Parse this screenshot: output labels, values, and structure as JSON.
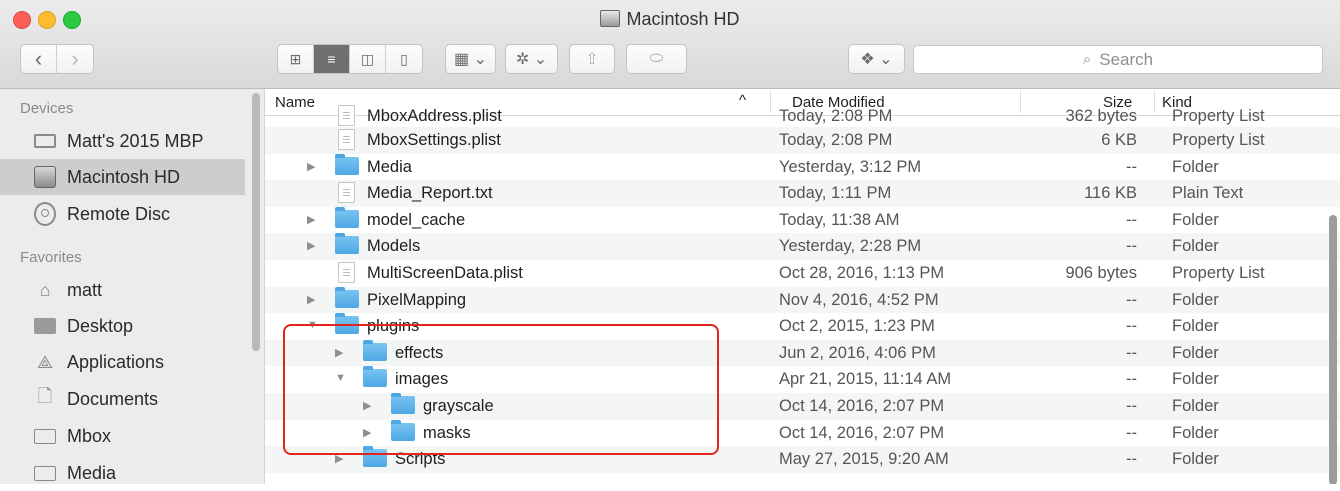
{
  "window": {
    "title": "Macintosh HD"
  },
  "toolbar": {
    "back_glyph": "‹",
    "forward_glyph": "›",
    "view_modes": [
      {
        "name": "icon-view-icon",
        "glyph": "⊞",
        "active": false
      },
      {
        "name": "list-view-icon",
        "glyph": "≡",
        "active": true
      },
      {
        "name": "column-view-icon",
        "glyph": "◫",
        "active": false
      },
      {
        "name": "coverflow-view-icon",
        "glyph": "▯",
        "active": false
      }
    ],
    "arrange_glyph": "▦ ⌄",
    "action_glyph": "✲ ⌄",
    "share_glyph": "⇧",
    "tag_glyph": "⬭",
    "dropbox_glyph": "❖ ⌄"
  },
  "search": {
    "placeholder": "Search",
    "icon": "search-icon"
  },
  "sidebar": {
    "devices_label": "Devices",
    "favorites_label": "Favorites",
    "devices": [
      {
        "label": "Matt's 2015 MBP",
        "icon": "laptop-icon",
        "selected": false
      },
      {
        "label": "Macintosh HD",
        "icon": "hard-drive-icon",
        "selected": true
      },
      {
        "label": "Remote Disc",
        "icon": "disc-icon",
        "selected": false
      }
    ],
    "favorites": [
      {
        "label": "matt",
        "icon": "home-icon"
      },
      {
        "label": "Desktop",
        "icon": "desktop-icon"
      },
      {
        "label": "Applications",
        "icon": "applications-icon"
      },
      {
        "label": "Documents",
        "icon": "documents-icon"
      },
      {
        "label": "Mbox",
        "icon": "folder-icon"
      },
      {
        "label": "Media",
        "icon": "folder-icon"
      }
    ]
  },
  "columns": {
    "name": "Name",
    "sort_indicator": "^",
    "date": "Date Modified",
    "size": "Size",
    "kind": "Kind"
  },
  "rows": [
    {
      "name": "MboxAddress.plist",
      "date": "Today, 2:08 PM",
      "size": "362 bytes",
      "kind": "Property List",
      "type": "file",
      "level": 0,
      "partial": true
    },
    {
      "name": "MboxSettings.plist",
      "date": "Today, 2:08 PM",
      "size": "6 KB",
      "kind": "Property List",
      "type": "file",
      "level": 0
    },
    {
      "name": "Media",
      "date": "Yesterday, 3:12 PM",
      "size": "--",
      "kind": "Folder",
      "type": "folder",
      "level": 0,
      "disclosure": "collapsed"
    },
    {
      "name": "Media_Report.txt",
      "date": "Today, 1:11 PM",
      "size": "116 KB",
      "kind": "Plain Text",
      "type": "file",
      "level": 0
    },
    {
      "name": "model_cache",
      "date": "Today, 11:38 AM",
      "size": "--",
      "kind": "Folder",
      "type": "folder",
      "level": 0,
      "disclosure": "collapsed"
    },
    {
      "name": "Models",
      "date": "Yesterday, 2:28 PM",
      "size": "--",
      "kind": "Folder",
      "type": "folder",
      "level": 0,
      "disclosure": "collapsed"
    },
    {
      "name": "MultiScreenData.plist",
      "date": "Oct 28, 2016, 1:13 PM",
      "size": "906 bytes",
      "kind": "Property List",
      "type": "file",
      "level": 0
    },
    {
      "name": "PixelMapping",
      "date": "Nov 4, 2016, 4:52 PM",
      "size": "--",
      "kind": "Folder",
      "type": "folder",
      "level": 0,
      "disclosure": "collapsed"
    },
    {
      "name": "plugins",
      "date": "Oct 2, 2015, 1:23 PM",
      "size": "--",
      "kind": "Folder",
      "type": "folder",
      "level": 0,
      "disclosure": "expanded"
    },
    {
      "name": "effects",
      "date": "Jun 2, 2016, 4:06 PM",
      "size": "--",
      "kind": "Folder",
      "type": "folder",
      "level": 1,
      "disclosure": "collapsed"
    },
    {
      "name": "images",
      "date": "Apr 21, 2015, 11:14 AM",
      "size": "--",
      "kind": "Folder",
      "type": "folder",
      "level": 1,
      "disclosure": "expanded"
    },
    {
      "name": "grayscale",
      "date": "Oct 14, 2016, 2:07 PM",
      "size": "--",
      "kind": "Folder",
      "type": "folder",
      "level": 2,
      "disclosure": "collapsed"
    },
    {
      "name": "masks",
      "date": "Oct 14, 2016, 2:07 PM",
      "size": "--",
      "kind": "Folder",
      "type": "folder",
      "level": 2,
      "disclosure": "collapsed"
    },
    {
      "name": "Scripts",
      "date": "May 27, 2015, 9:20 AM",
      "size": "--",
      "kind": "Folder",
      "type": "folder",
      "level": 1,
      "disclosure": "collapsed"
    }
  ],
  "colors": {
    "folder": "#5ab2ea",
    "highlight": "#e0261f",
    "selection": "#cdcdcd"
  }
}
